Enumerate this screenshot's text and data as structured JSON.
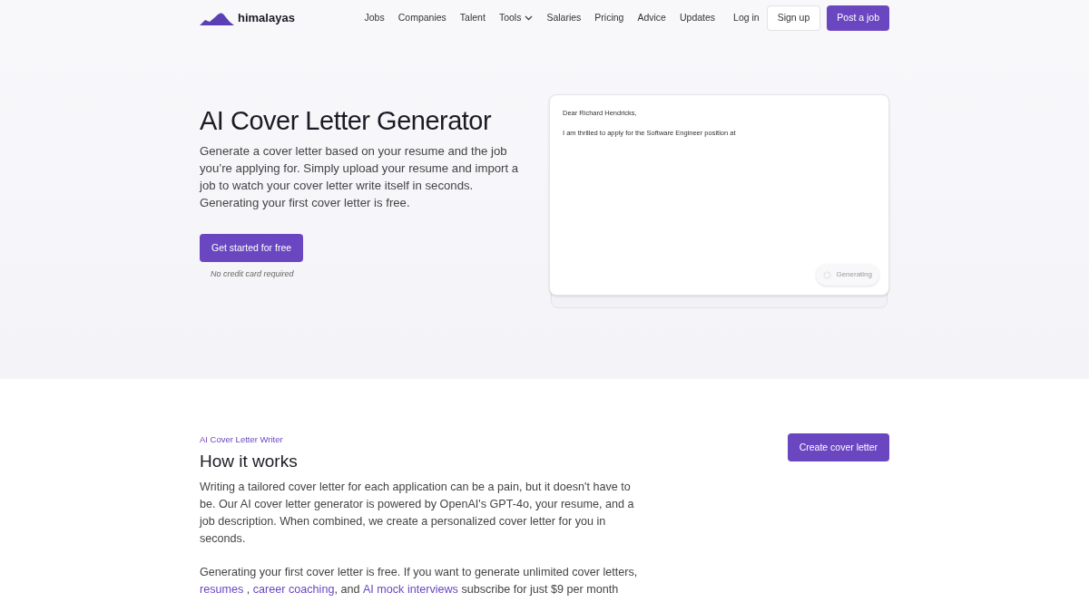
{
  "brand": "himalayas",
  "nav": [
    {
      "label": "Jobs",
      "has_menu": false
    },
    {
      "label": "Companies",
      "has_menu": false
    },
    {
      "label": "Talent",
      "has_menu": false
    },
    {
      "label": "Tools",
      "has_menu": true
    },
    {
      "label": "Salaries",
      "has_menu": false
    },
    {
      "label": "Pricing",
      "has_menu": false
    },
    {
      "label": "Advice",
      "has_menu": false
    },
    {
      "label": "Updates",
      "has_menu": false
    }
  ],
  "auth": {
    "login": "Log in",
    "signup": "Sign up",
    "post": "Post a job"
  },
  "hero": {
    "title": "AI Cover Letter Generator",
    "text": "Generate a cover letter based on your resume and the job you’re applying for. Simply upload your resume and import a job to watch your cover letter write itself in seconds. Generating your first cover letter is free.",
    "cta": "Get started for free",
    "note": "No credit card required"
  },
  "preview": {
    "greeting": "Dear Richard Hendricks,",
    "line": "I am thrilled to apply for the Software Engineer position at",
    "status": "Generating"
  },
  "how": {
    "eyebrow": "AI Cover Letter Writer",
    "title": "How it works",
    "button": "Create cover letter",
    "paragraph": "Writing a tailored cover letter for each application can be a pain, but it doesn't have to be. Our AI cover letter generator is powered by OpenAI's GPT-4o, your resume, and a job description. When combined, we create a personalized cover letter for you in seconds.",
    "segments": [
      {
        "kind": "text",
        "text": "Generating your first cover letter is free. If you want to generate unlimited cover letters, "
      },
      {
        "kind": "link",
        "text": "resumes"
      },
      {
        "kind": "text",
        "text": " , "
      },
      {
        "kind": "link",
        "text": "career coaching"
      },
      {
        "kind": "text",
        "text": ", and "
      },
      {
        "kind": "link",
        "text": "AI mock interviews"
      },
      {
        "kind": "text",
        "text": " subscribe for just $9 per month"
      }
    ]
  }
}
